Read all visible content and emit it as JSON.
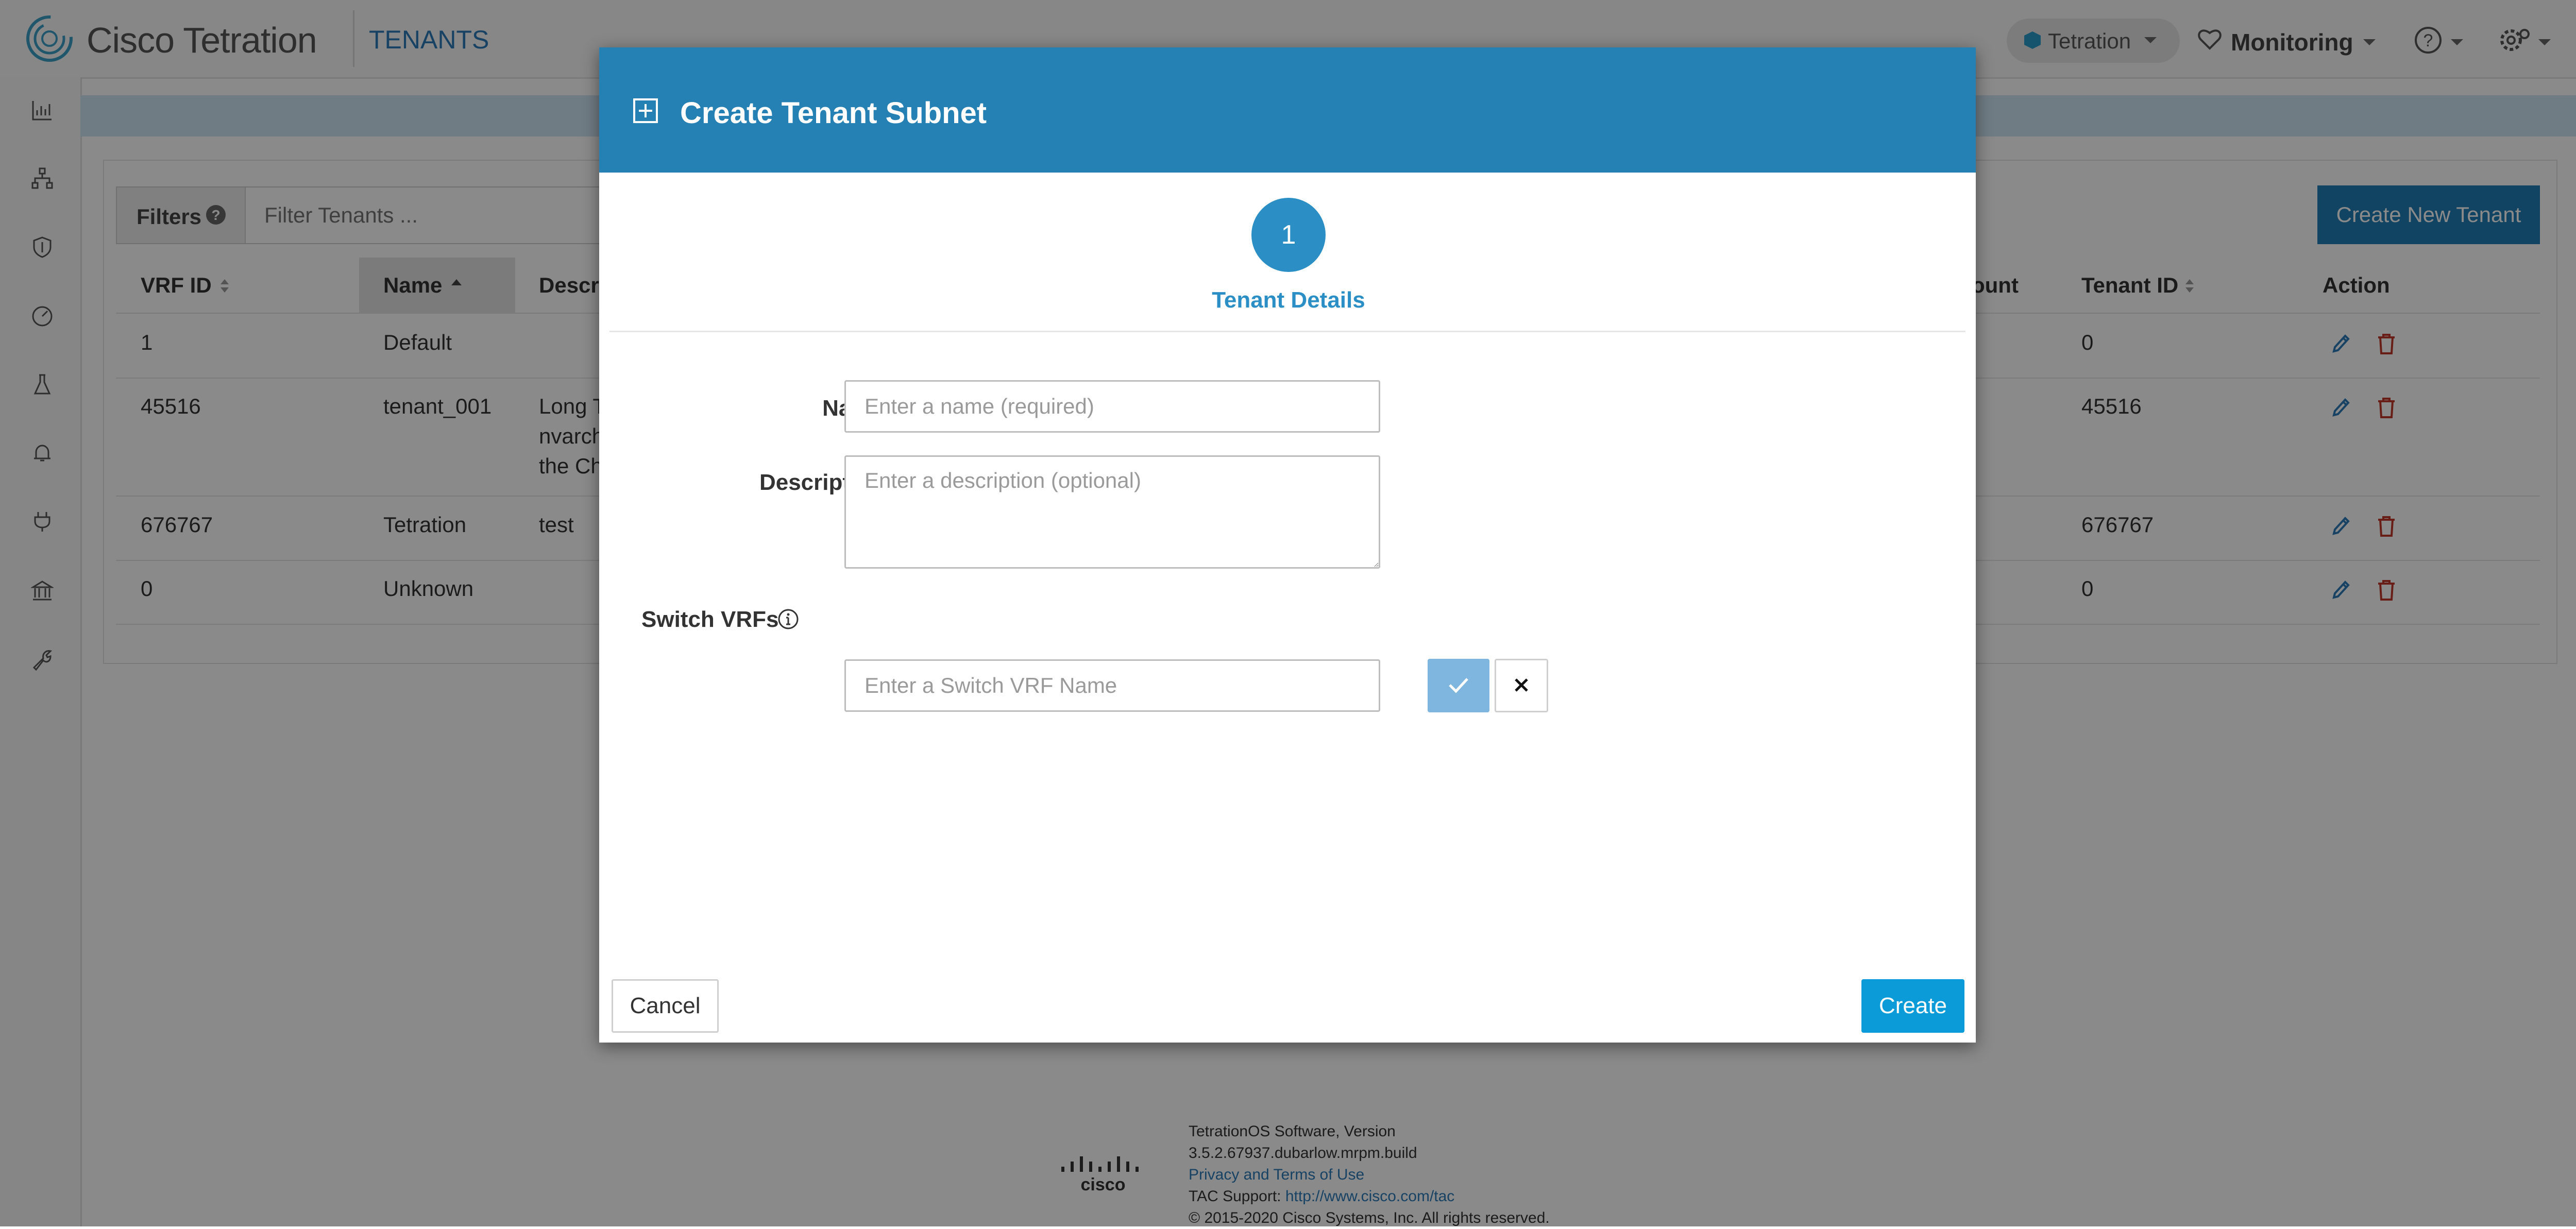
{
  "app": {
    "logo_text": "Cisco Tetration",
    "page_label": "TENANTS",
    "header_menu": [
      {
        "label": "Tetration",
        "icon": "cube-icon"
      },
      {
        "label": "Monitoring",
        "icon": "heart-pulse-icon"
      }
    ]
  },
  "toolbar": {
    "filters_label": "Filters",
    "filter_placeholder": "Filter Tenants ...",
    "create_button": "Create New Tenant"
  },
  "table": {
    "columns": [
      "VRF ID",
      "Name",
      "Descr",
      "ount",
      "Tenant ID",
      "Action"
    ],
    "rows": [
      {
        "vrf_id": "1",
        "name": "Default",
        "description": "",
        "tenant_id": "0"
      },
      {
        "vrf_id": "45516",
        "name": "tenant_001",
        "description_lines": [
          "Long T",
          "nvarch",
          "the Ch"
        ],
        "tenant_id": "45516"
      },
      {
        "vrf_id": "676767",
        "name": "Tetration",
        "description": "test",
        "tenant_id": "676767"
      },
      {
        "vrf_id": "0",
        "name": "Unknown",
        "description": "",
        "tenant_id": "0"
      }
    ]
  },
  "modal": {
    "title": "Create Tenant Subnet",
    "step_number": "1",
    "step_label": "Tenant Details",
    "name_label": "Name",
    "name_placeholder": "Enter a name (required)",
    "description_label": "Description",
    "description_placeholder": "Enter a description (optional)",
    "switch_vrfs_label": "Switch VRFs",
    "switch_vrf_placeholder": "Enter a Switch VRF Name",
    "cancel_label": "Cancel",
    "create_label": "Create"
  },
  "footer": {
    "lines": [
      "TetrationOS Software, Version",
      "3.5.2.67937.dubarlow.mrpm.build",
      "Privacy and Terms of Use",
      "TAC Support: ",
      "© 2015-2020 Cisco Systems, Inc. All rights reserved."
    ],
    "tac_link": "http://www.cisco.com/tac"
  },
  "colors": {
    "brand_blue": "#2580b3",
    "create_blue": "#0a9bd8",
    "delete_red": "#c0392b"
  }
}
